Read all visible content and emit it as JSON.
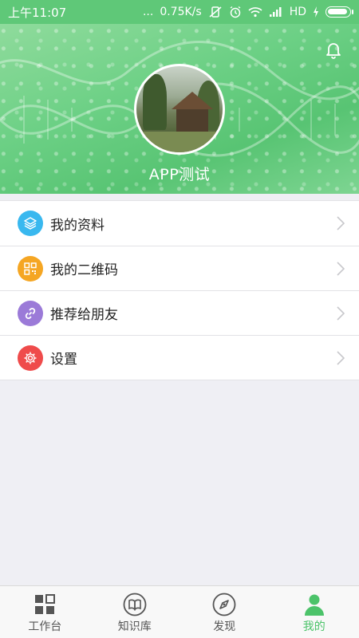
{
  "status_bar": {
    "time": "上午11:07",
    "dots": "...",
    "speed": "0.75K/s",
    "network": "HD",
    "icons": [
      "no-vibrate-icon",
      "alarm-icon",
      "wifi-icon",
      "signal-icon",
      "charging-icon",
      "battery-icon"
    ]
  },
  "header": {
    "username": "APP测试",
    "bell_icon": "bell-icon",
    "avatar_alt": "avatar"
  },
  "menu": {
    "items": [
      {
        "label": "我的资料",
        "icon": "layers-icon",
        "color": "#39b8ef"
      },
      {
        "label": "我的二维码",
        "icon": "qrcode-icon",
        "color": "#f5a623"
      },
      {
        "label": "推荐给朋友",
        "icon": "link-icon",
        "color": "#9b7ad8"
      },
      {
        "label": "设置",
        "icon": "gear-icon",
        "color": "#ef4b4b"
      }
    ]
  },
  "tabbar": {
    "tabs": [
      {
        "label": "工作台",
        "icon": "grid-icon",
        "active": false
      },
      {
        "label": "知识库",
        "icon": "book-icon",
        "active": false
      },
      {
        "label": "发现",
        "icon": "compass-icon",
        "active": false
      },
      {
        "label": "我的",
        "icon": "person-icon",
        "active": true
      }
    ]
  },
  "colors": {
    "accent": "#4cc36a",
    "status_bar": "#5fc878",
    "background": "#efeff4"
  }
}
